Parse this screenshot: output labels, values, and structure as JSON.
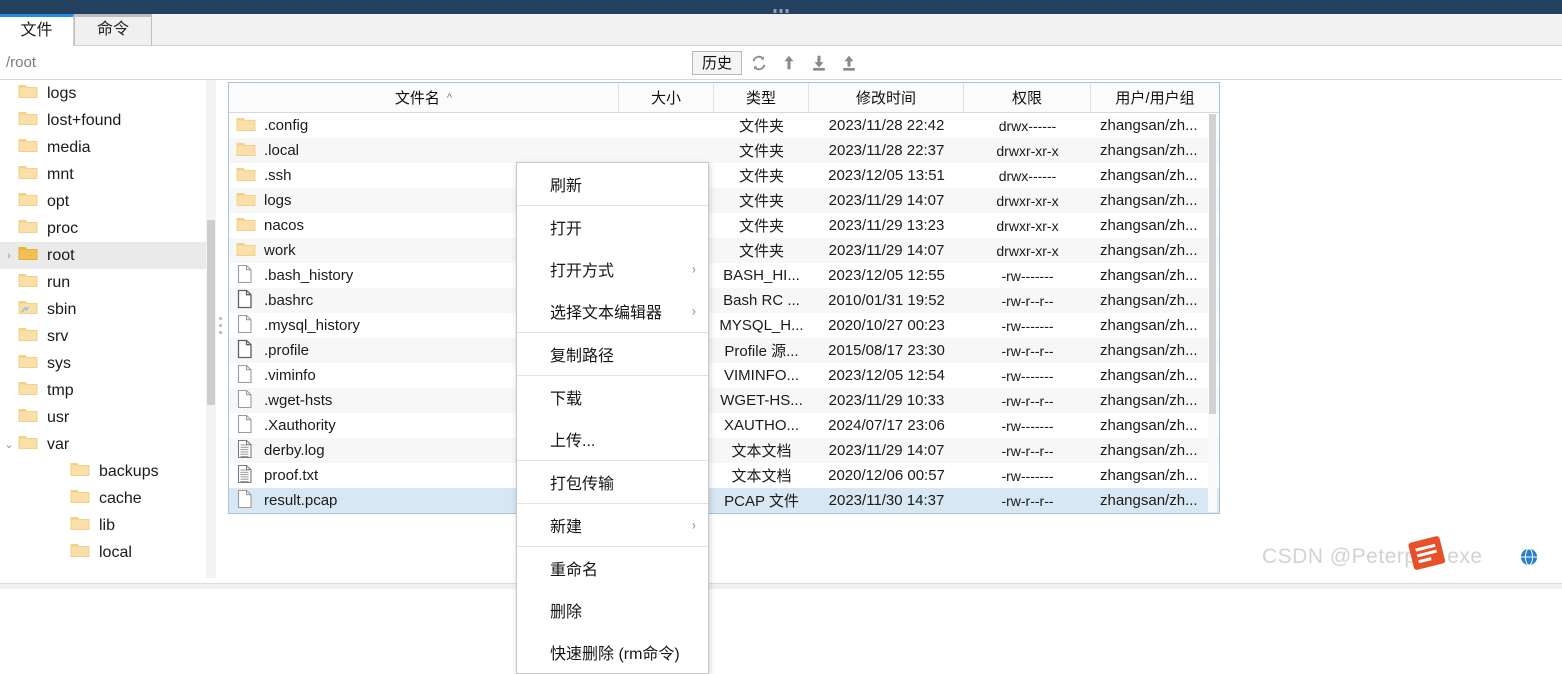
{
  "window": {
    "title_bar_color": "#23415f"
  },
  "tabs": [
    {
      "label": "文件",
      "active": true,
      "name": "tab-files"
    },
    {
      "label": "命令",
      "active": false,
      "name": "tab-command"
    }
  ],
  "pathbar": {
    "path": "/root",
    "history_button": "历史",
    "icons": [
      {
        "name": "refresh-icon",
        "title": "刷新"
      },
      {
        "name": "up-level-icon",
        "title": "上级目录"
      },
      {
        "name": "download-icon",
        "title": "下载"
      },
      {
        "name": "upload-icon",
        "title": "上传"
      }
    ]
  },
  "tree": {
    "items": [
      {
        "label": "logs",
        "indent": 1,
        "icon": "folder-icon",
        "chevron": "",
        "selected": false
      },
      {
        "label": "lost+found",
        "indent": 1,
        "icon": "folder-icon",
        "chevron": "",
        "selected": false
      },
      {
        "label": "media",
        "indent": 1,
        "icon": "folder-icon",
        "chevron": "",
        "selected": false
      },
      {
        "label": "mnt",
        "indent": 1,
        "icon": "folder-icon",
        "chevron": "",
        "selected": false
      },
      {
        "label": "opt",
        "indent": 1,
        "icon": "folder-icon",
        "chevron": "",
        "selected": false
      },
      {
        "label": "proc",
        "indent": 1,
        "icon": "folder-icon",
        "chevron": "",
        "selected": false
      },
      {
        "label": "root",
        "indent": 1,
        "icon": "folder-icon",
        "chevron": "›",
        "selected": true
      },
      {
        "label": "run",
        "indent": 1,
        "icon": "folder-icon",
        "chevron": "",
        "selected": false
      },
      {
        "label": "sbin",
        "indent": 1,
        "icon": "folder-link-icon",
        "chevron": "",
        "selected": false
      },
      {
        "label": "srv",
        "indent": 1,
        "icon": "folder-icon",
        "chevron": "",
        "selected": false
      },
      {
        "label": "sys",
        "indent": 1,
        "icon": "folder-icon",
        "chevron": "",
        "selected": false
      },
      {
        "label": "tmp",
        "indent": 1,
        "icon": "folder-icon",
        "chevron": "",
        "selected": false
      },
      {
        "label": "usr",
        "indent": 1,
        "icon": "folder-icon",
        "chevron": "",
        "selected": false
      },
      {
        "label": "var",
        "indent": 1,
        "icon": "folder-icon",
        "chevron": "⌄",
        "selected": false
      },
      {
        "label": "backups",
        "indent": 2,
        "icon": "folder-icon",
        "chevron": "",
        "selected": false
      },
      {
        "label": "cache",
        "indent": 2,
        "icon": "folder-icon",
        "chevron": "",
        "selected": false
      },
      {
        "label": "lib",
        "indent": 2,
        "icon": "folder-icon",
        "chevron": "",
        "selected": false
      },
      {
        "label": "local",
        "indent": 2,
        "icon": "folder-icon",
        "chevron": "",
        "selected": false
      }
    ]
  },
  "filelist": {
    "columns": [
      {
        "key": "name",
        "label": "文件名",
        "sort": "asc"
      },
      {
        "key": "size",
        "label": "大小",
        "sort": ""
      },
      {
        "key": "type",
        "label": "类型",
        "sort": ""
      },
      {
        "key": "time",
        "label": "修改时间",
        "sort": ""
      },
      {
        "key": "perm",
        "label": "权限",
        "sort": ""
      },
      {
        "key": "user",
        "label": "用户/用户组",
        "sort": ""
      }
    ],
    "sort_asc_glyph": "︿",
    "rows": [
      {
        "name": ".config",
        "icon": "folder-icon",
        "size": "",
        "type": "文件夹",
        "time": "2023/11/28 22:42",
        "perm": "drwx------",
        "user": "zhangsan/zh...",
        "selected": false
      },
      {
        "name": ".local",
        "icon": "folder-icon",
        "size": "",
        "type": "文件夹",
        "time": "2023/11/28 22:37",
        "perm": "drwxr-xr-x",
        "user": "zhangsan/zh...",
        "selected": false
      },
      {
        "name": ".ssh",
        "icon": "folder-icon",
        "size": "",
        "type": "文件夹",
        "time": "2023/12/05 13:51",
        "perm": "drwx------",
        "user": "zhangsan/zh...",
        "selected": false
      },
      {
        "name": "logs",
        "icon": "folder-icon",
        "size": "",
        "type": "文件夹",
        "time": "2023/11/29 14:07",
        "perm": "drwxr-xr-x",
        "user": "zhangsan/zh...",
        "selected": false
      },
      {
        "name": "nacos",
        "icon": "folder-icon",
        "size": "",
        "type": "文件夹",
        "time": "2023/11/29 13:23",
        "perm": "drwxr-xr-x",
        "user": "zhangsan/zh...",
        "selected": false
      },
      {
        "name": "work",
        "icon": "folder-icon",
        "size": "",
        "type": "文件夹",
        "time": "2023/11/29 14:07",
        "perm": "drwxr-xr-x",
        "user": "zhangsan/zh...",
        "selected": false
      },
      {
        "name": ".bash_history",
        "icon": "file-blank-icon",
        "size": "",
        "type": "BASH_HI...",
        "time": "2023/12/05 12:55",
        "perm": "-rw-------",
        "user": "zhangsan/zh...",
        "selected": false
      },
      {
        "name": ".bashrc",
        "icon": "file-plain-icon",
        "size": "",
        "type": "Bash RC ...",
        "time": "2010/01/31 19:52",
        "perm": "-rw-r--r--",
        "user": "zhangsan/zh...",
        "selected": false
      },
      {
        "name": ".mysql_history",
        "icon": "file-blank-icon",
        "size": "",
        "type": "MYSQL_H...",
        "time": "2020/10/27 00:23",
        "perm": "-rw-------",
        "user": "zhangsan/zh...",
        "selected": false
      },
      {
        "name": ".profile",
        "icon": "file-plain-icon",
        "size": "",
        "type": "Profile 源...",
        "time": "2015/08/17 23:30",
        "perm": "-rw-r--r--",
        "user": "zhangsan/zh...",
        "selected": false
      },
      {
        "name": ".viminfo",
        "icon": "file-blank-icon",
        "size": "",
        "type": "VIMINFO...",
        "time": "2023/12/05 12:54",
        "perm": "-rw-------",
        "user": "zhangsan/zh...",
        "selected": false
      },
      {
        "name": ".wget-hsts",
        "icon": "file-blank-icon",
        "size": "",
        "type": "WGET-HS...",
        "time": "2023/11/29 10:33",
        "perm": "-rw-r--r--",
        "user": "zhangsan/zh...",
        "selected": false
      },
      {
        "name": ".Xauthority",
        "icon": "file-blank-icon",
        "size": "",
        "type": "XAUTHO...",
        "time": "2024/07/17 23:06",
        "perm": "-rw-------",
        "user": "zhangsan/zh...",
        "selected": false
      },
      {
        "name": "derby.log",
        "icon": "file-text-icon",
        "size": "",
        "type": "文本文档",
        "time": "2023/11/29 14:07",
        "perm": "-rw-r--r--",
        "user": "zhangsan/zh...",
        "selected": false
      },
      {
        "name": "proof.txt",
        "icon": "file-text-icon",
        "size": "",
        "type": "文本文档",
        "time": "2020/12/06 00:57",
        "perm": "-rw-------",
        "user": "zhangsan/zh...",
        "selected": false
      },
      {
        "name": "result.pcap",
        "icon": "file-blank-icon",
        "size": "",
        "type": "PCAP 文件",
        "time": "2023/11/30 14:37",
        "perm": "-rw-r--r--",
        "user": "zhangsan/zh...",
        "selected": true
      }
    ]
  },
  "context_menu": {
    "items": [
      {
        "label": "刷新",
        "submenu": false,
        "separator_after": true
      },
      {
        "label": "打开",
        "submenu": false,
        "separator_after": false
      },
      {
        "label": "打开方式",
        "submenu": true,
        "separator_after": false
      },
      {
        "label": "选择文本编辑器",
        "submenu": true,
        "separator_after": true
      },
      {
        "label": "复制路径",
        "submenu": false,
        "separator_after": true
      },
      {
        "label": "下载",
        "submenu": false,
        "separator_after": false
      },
      {
        "label": "上传...",
        "submenu": false,
        "separator_after": true
      },
      {
        "label": "打包传输",
        "submenu": false,
        "separator_after": true
      },
      {
        "label": "新建",
        "submenu": true,
        "separator_after": true
      },
      {
        "label": "重命名",
        "submenu": false,
        "separator_after": false
      },
      {
        "label": "删除",
        "submenu": false,
        "separator_after": false
      },
      {
        "label": "快速删除 (rm命令)",
        "submenu": false,
        "separator_after": false
      }
    ],
    "submenu_glyph": "›"
  },
  "watermark": {
    "text": "CSDN @Peterpan.exe"
  },
  "colors": {
    "accent": "#1a8fe3",
    "titlebar": "#23415f",
    "selection": "#d7e7f3",
    "folder": "#f6d187"
  }
}
